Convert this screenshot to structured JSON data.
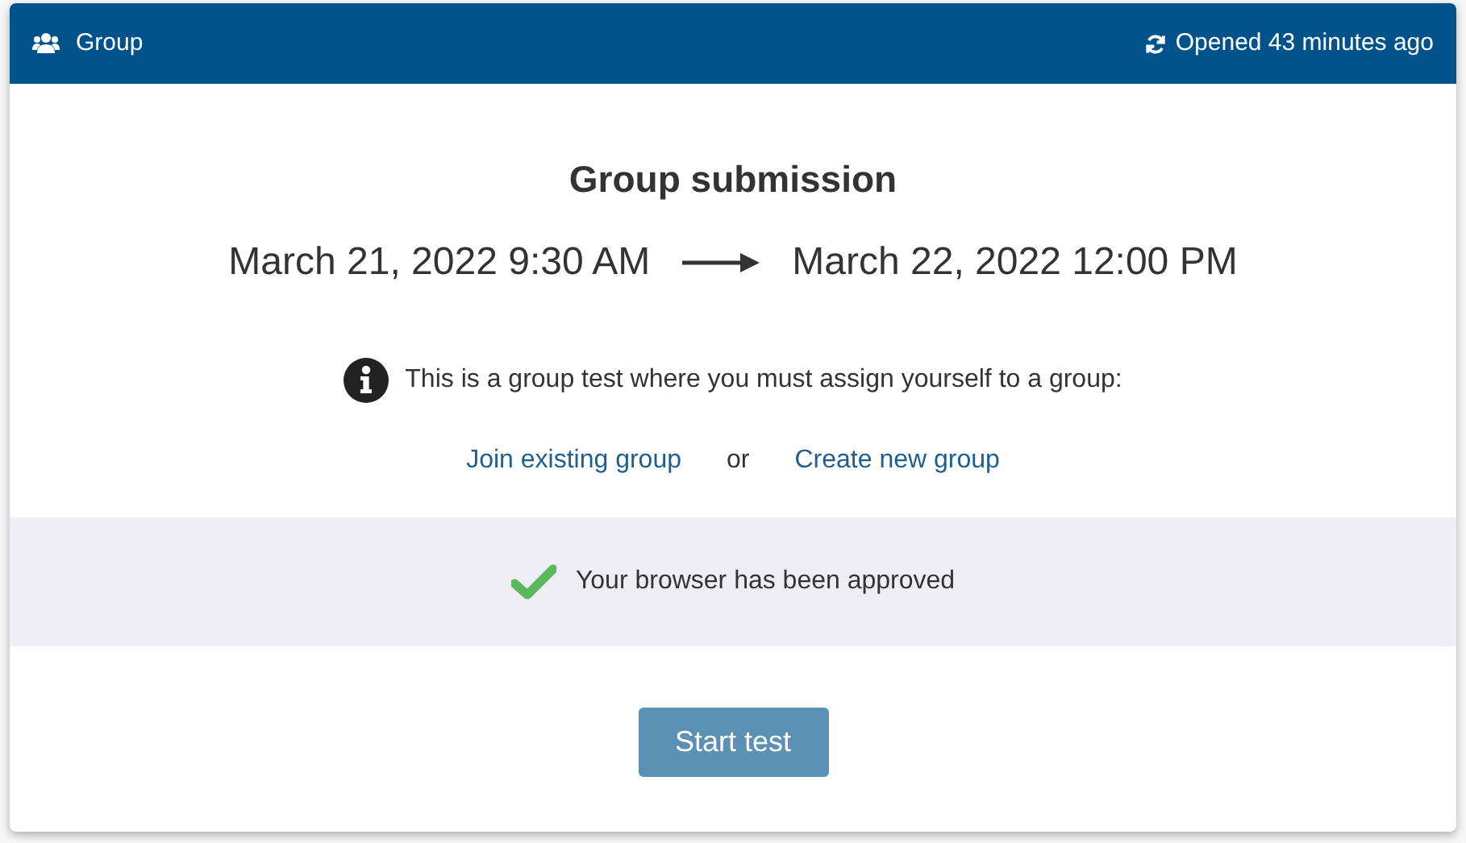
{
  "header": {
    "title": "Group",
    "status": "Opened 43 minutes ago"
  },
  "title": "Group submission",
  "period": {
    "start": "March 21, 2022 9:30 AM",
    "end": "March 22, 2022 12:00 PM"
  },
  "info": "This is a group test where you must assign yourself to a group:",
  "choices": {
    "join": "Join existing group",
    "separator": "or",
    "create": "Create new group"
  },
  "browser_check": {
    "message": "Your browser has been approved"
  },
  "start_button": "Start test"
}
